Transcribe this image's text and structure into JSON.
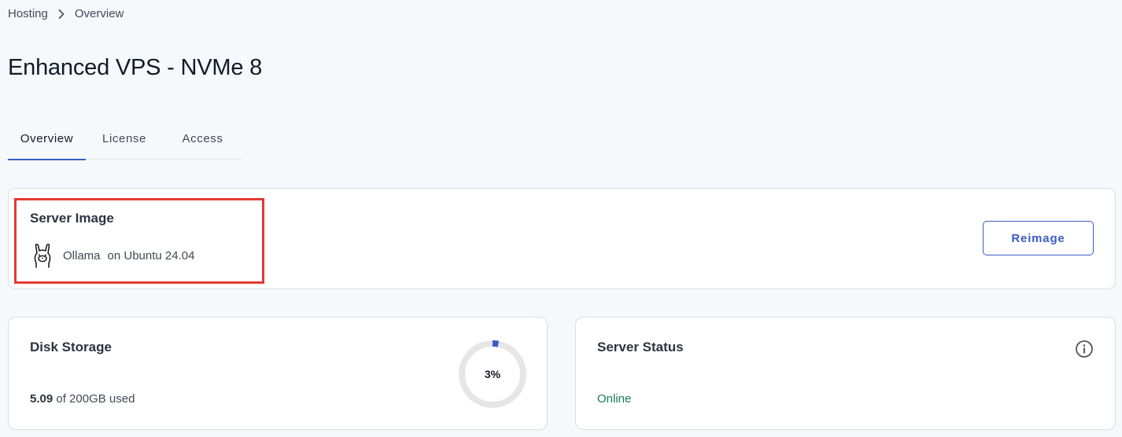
{
  "breadcrumb": {
    "items": [
      "Hosting",
      "Overview"
    ],
    "separator_icon": "chevron-right-icon"
  },
  "page": {
    "title": "Enhanced VPS - NVMe 8"
  },
  "tabs": [
    {
      "label": "Overview",
      "active": true
    },
    {
      "label": "License",
      "active": false
    },
    {
      "label": "Access",
      "active": false
    }
  ],
  "server_image": {
    "heading": "Server Image",
    "icon": "llama-icon",
    "name": "Ollama",
    "os": "on Ubuntu 24.04",
    "reimage_label": "Reimage"
  },
  "disk_storage": {
    "heading": "Disk Storage",
    "used": "5.09",
    "total_text": "of 200GB used",
    "percent_label": "3%",
    "percent": 3
  },
  "server_status": {
    "heading": "Server Status",
    "info_icon": "info-icon",
    "status": "Online"
  },
  "colors": {
    "accent": "#3b5cc7",
    "highlight": "#e53935",
    "status_online": "#157a5a",
    "donut_track": "#e6e6e6"
  }
}
